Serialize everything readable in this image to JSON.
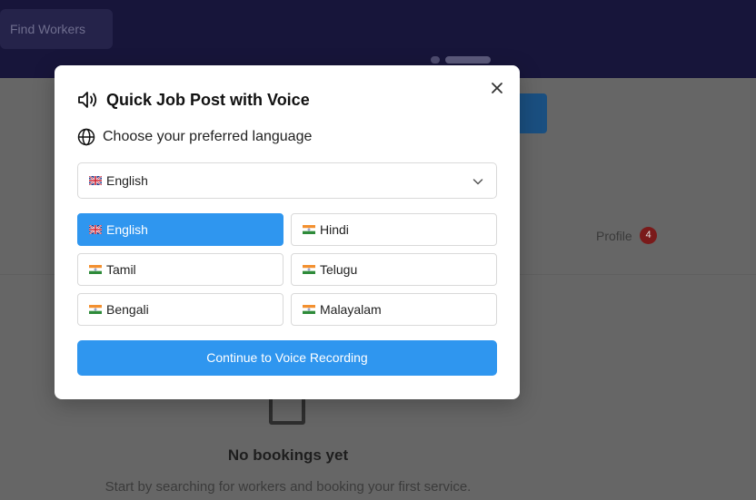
{
  "background": {
    "find_workers_label": "Find Workers",
    "profile_label": "Profile",
    "profile_badge": "4",
    "empty_title": "No bookings yet",
    "empty_subtitle": "Start by searching for workers and booking your first service."
  },
  "modal": {
    "title": "Quick Job Post with Voice",
    "language_prompt": "Choose your preferred language",
    "selected_language": "English",
    "languages": [
      {
        "label": "English",
        "flag": "uk-flag",
        "active": true
      },
      {
        "label": "Hindi",
        "flag": "india-flag",
        "active": false
      },
      {
        "label": "Tamil",
        "flag": "india-flag",
        "active": false
      },
      {
        "label": "Telugu",
        "flag": "india-flag",
        "active": false
      },
      {
        "label": "Bengali",
        "flag": "india-flag",
        "active": false
      },
      {
        "label": "Malayalam",
        "flag": "india-flag",
        "active": false
      }
    ],
    "continue_label": "Continue to Voice Recording",
    "close_icon": "close-icon"
  },
  "colors": {
    "accent": "#2f96ef",
    "header_bg": "#17153a"
  }
}
